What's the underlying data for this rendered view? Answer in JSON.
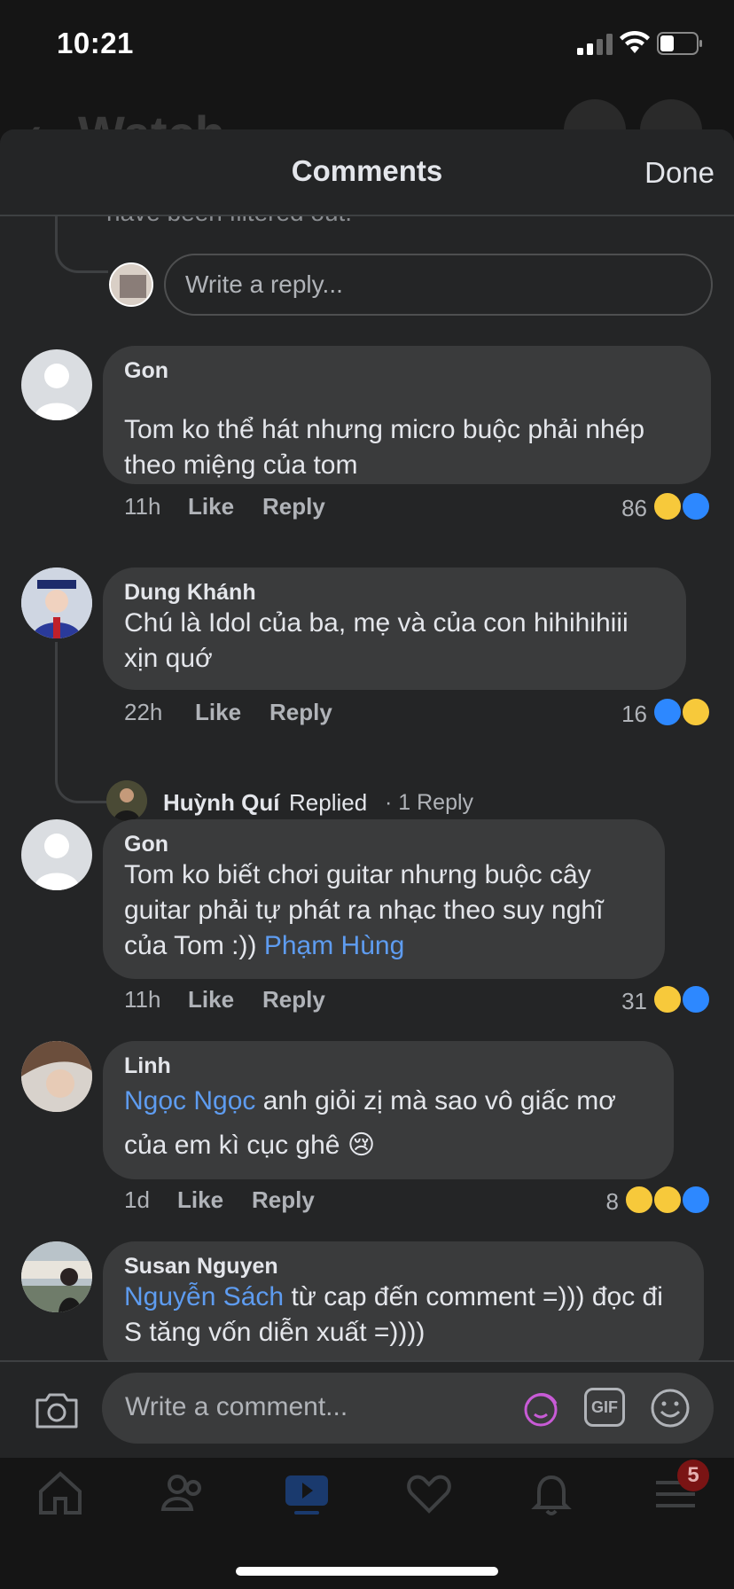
{
  "status_bar": {
    "time": "10:21"
  },
  "background": {
    "title": "Watch"
  },
  "sheet": {
    "title": "Comments",
    "done_label": "Done"
  },
  "thread_top": {
    "filtered_note": "have been filtered out.",
    "reply_placeholder": "Write a reply..."
  },
  "comments": [
    {
      "author": "Gon",
      "text": "Tom ko thể hát nhưng micro buộc phải nhép theo miệng của tom",
      "mention": "",
      "time": "11h",
      "like_label": "Like",
      "reply_label": "Reply",
      "reaction_count": "86",
      "reactions": [
        "haha",
        "like"
      ]
    },
    {
      "author": "Dung Khánh",
      "text": "Chú là Idol của ba, mẹ và của con hihihihiii xịn quớ",
      "mention": "",
      "time": "22h",
      "like_label": "Like",
      "reply_label": "Reply",
      "reaction_count": "16",
      "reactions": [
        "like",
        "haha"
      ],
      "reply_summary": {
        "name": "Huỳnh Quí",
        "action": "Replied",
        "count": "· 1 Reply"
      }
    },
    {
      "author": "Gon",
      "text": "Tom ko biết chơi guitar nhưng buộc cây guitar phải tự phát ra nhạc theo suy nghĩ của Tom :))",
      "mention": "Phạm Hùng",
      "time": "11h",
      "like_label": "Like",
      "reply_label": "Reply",
      "reaction_count": "31",
      "reactions": [
        "haha",
        "like"
      ]
    },
    {
      "author": "Linh",
      "mention": "Ngọc Ngọc",
      "text": "anh giỏi zị mà sao vô giấc mơ của em kì cục ghê",
      "emoji": "😢",
      "time": "1d",
      "like_label": "Like",
      "reply_label": "Reply",
      "reaction_count": "8",
      "reactions": [
        "haha",
        "sad",
        "like"
      ]
    },
    {
      "author": "Susan Nguyen",
      "mention": "Nguyễn Sách",
      "text": "từ cap đến comment =))) đọc đi S tăng vốn diễn xuất =))))"
    }
  ],
  "composer": {
    "placeholder": "Write a comment...",
    "gif_label": "GIF"
  },
  "nav": {
    "items": [
      "home-icon",
      "friends-icon",
      "watch-icon",
      "dating-icon",
      "notifications-icon",
      "menu-icon"
    ],
    "menu_badge": "5"
  },
  "colors": {
    "sheet_bg": "#242526",
    "bubble_bg": "#3a3b3c",
    "mention": "#5e9cf0",
    "like_blue": "#2d88ff"
  }
}
